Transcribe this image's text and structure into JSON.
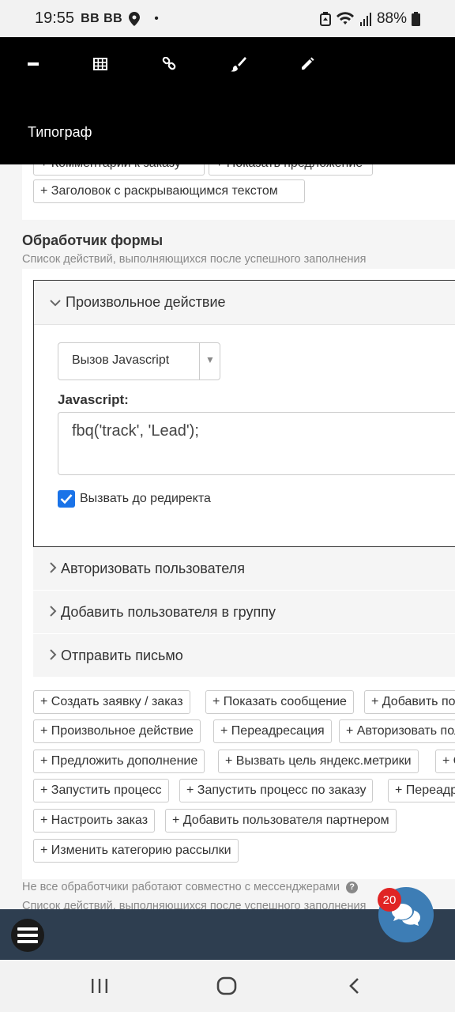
{
  "status_bar": {
    "time": "19:55",
    "carrier": "BB BB",
    "dot": "•",
    "battery": "88%"
  },
  "toolbar": {
    "icons": [
      "minus-icon",
      "table-icon",
      "link-icon",
      "brush-icon",
      "pencil-icon"
    ],
    "typograph": "Типограф"
  },
  "top_chips": {
    "cut_left": "+ Комментарии к заказу",
    "cut_right": "+ Показать предложение",
    "heading_toggle": "+ Заголовок с раскрывающимся текстом"
  },
  "form_handler": {
    "title": "Обработчик формы",
    "subtitle": "Список действий, выполняющихся после успешного заполнения",
    "open_action": {
      "label": "Произвольное действие",
      "select_value": "Вызов Javascript",
      "js_label": "Javascript:",
      "js_value": "fbq('track', 'Lead');",
      "checkbox_label": "Вызвать до редиректа",
      "checkbox_checked": true
    },
    "collapsed_actions": [
      "Авторизовать пользователя",
      "Добавить пользователя в группу",
      "Отправить письмо"
    ],
    "add_buttons": [
      [
        "+ Создать заявку / заказ",
        "+ Показать сообщение",
        "+ Добавить пользователя"
      ],
      [
        "+ Произвольное действие",
        "+ Переадресация",
        "+ Авторизовать пользователя"
      ],
      [
        "+ Предложить дополнение",
        "+ Вызвать цель яндекс.метрики",
        "+ Отправить"
      ],
      [
        "+ Запустить процесс",
        "+ Запустить процесс по заказу",
        "+ Переадресация"
      ],
      [
        "+ Настроить заказ",
        "+ Добавить пользователя партнером"
      ],
      [
        "+ Изменить категорию рассылки"
      ]
    ]
  },
  "footer": {
    "note": "Не все обработчики работают совместно с мессенджерами",
    "note2": "Список действий, выполняющихся после успешного заполнения"
  },
  "chat": {
    "badge": "20"
  },
  "colors": {
    "toolbar_bg": "#000000",
    "dark_bar": "#2e3e50",
    "chat_button": "#3d7db5",
    "badge": "#e02424",
    "checkbox": "#1a73e8"
  }
}
